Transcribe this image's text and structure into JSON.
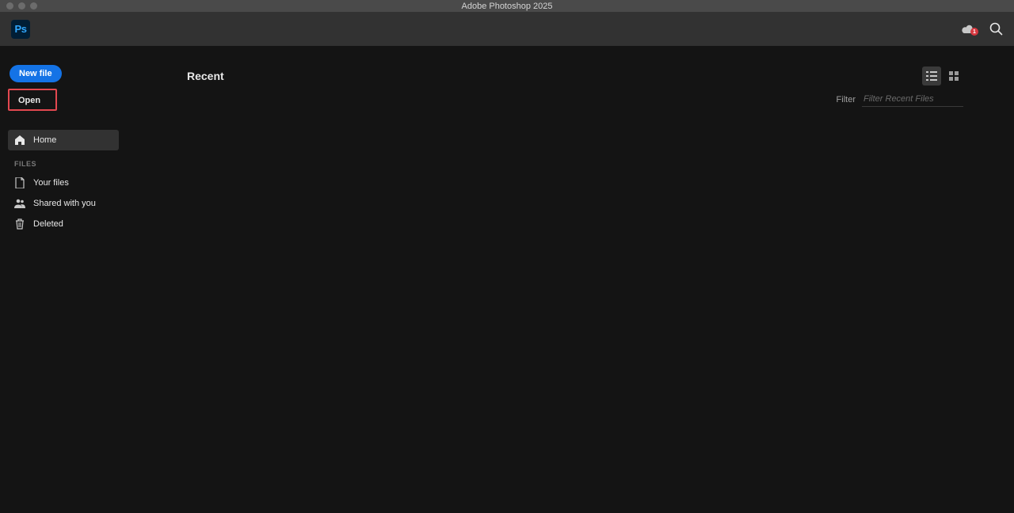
{
  "window": {
    "title": "Adobe Photoshop 2025"
  },
  "topbar": {
    "logo_text": "Ps",
    "notification_count": "1"
  },
  "sidebar": {
    "new_file_label": "New file",
    "open_label": "Open",
    "home_label": "Home",
    "files_heading": "FILES",
    "your_files_label": "Your files",
    "shared_label": "Shared with you",
    "deleted_label": "Deleted"
  },
  "content": {
    "recent_title": "Recent",
    "filter_label": "Filter",
    "filter_placeholder": "Filter Recent Files"
  }
}
